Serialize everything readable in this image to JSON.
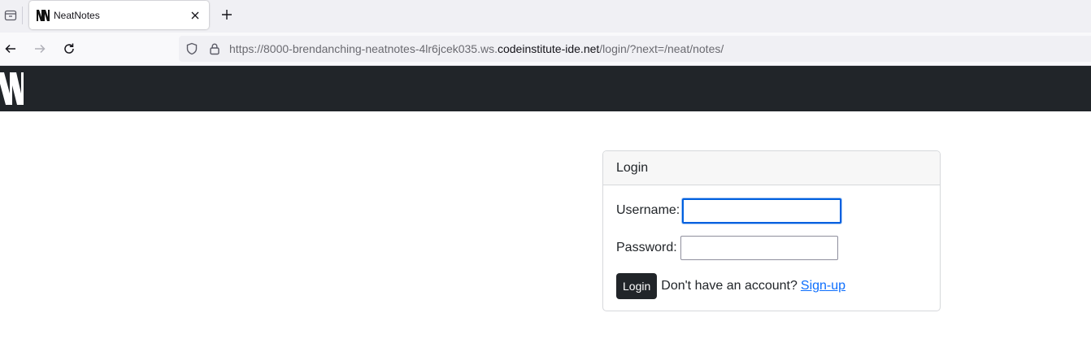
{
  "browser": {
    "tab": {
      "title": "NeatNotes"
    },
    "url": {
      "prefix": "https://8000-brendanching-neatnotes-4lr6jcek035.ws.",
      "domain": "codeinstitute-ide.net",
      "path": "/login/?next=/neat/notes/"
    }
  },
  "login": {
    "header": "Login",
    "username_label": "Username:",
    "username_value": "",
    "password_label": "Password:",
    "password_value": "",
    "submit_label": "Login",
    "signup_prompt": "Don't have an account?",
    "signup_link": "Sign-up"
  },
  "colors": {
    "site_header": "#212529",
    "link": "#0d6efd",
    "focus": "#0060df"
  }
}
